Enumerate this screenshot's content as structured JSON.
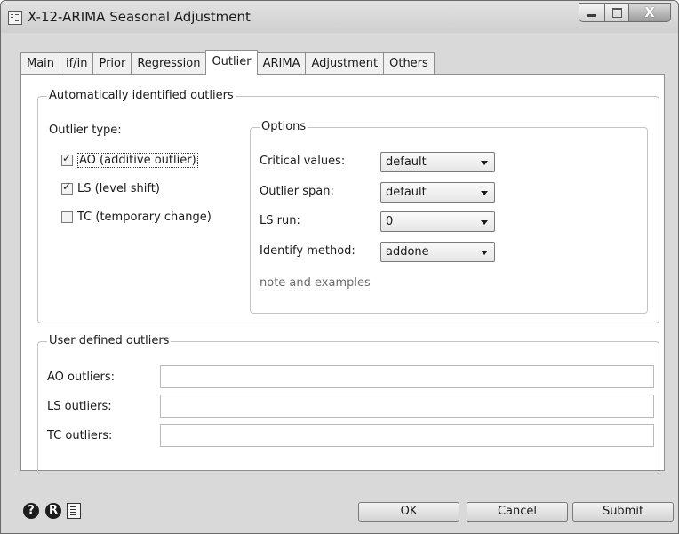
{
  "window": {
    "title": "X-12-ARIMA Seasonal Adjustment",
    "icons": [
      "dialog-icon",
      "minimize-icon",
      "maximize-icon",
      "close-icon"
    ],
    "close_glyph": "X"
  },
  "tabs": [
    {
      "label": "Main",
      "active": false
    },
    {
      "label": "if/in",
      "active": false
    },
    {
      "label": "Prior",
      "active": false
    },
    {
      "label": "Regression",
      "active": false
    },
    {
      "label": "Outlier",
      "active": true
    },
    {
      "label": "ARIMA",
      "active": false
    },
    {
      "label": "Adjustment",
      "active": false
    },
    {
      "label": "Others",
      "active": false
    }
  ],
  "auto": {
    "legend": "Automatically identified outliers",
    "outlier_type_label": "Outlier type:",
    "checkboxes": [
      {
        "label": "AO (additive outlier)",
        "checked": true
      },
      {
        "label": "LS (level shift)",
        "checked": true
      },
      {
        "label": "TC (temporary change)",
        "checked": false
      }
    ],
    "options": {
      "legend": "Options",
      "critical_values": {
        "label": "Critical values:",
        "value": "default"
      },
      "outlier_span": {
        "label": "Outlier span:",
        "value": "default"
      },
      "ls_run": {
        "label": "LS run:",
        "value": "0"
      },
      "identify_method": {
        "label": "Identify method:",
        "value": "addone"
      },
      "note_link": "note and examples"
    }
  },
  "user": {
    "legend": "User defined outliers",
    "fields": [
      {
        "label": "AO outliers:",
        "value": ""
      },
      {
        "label": "LS outliers:",
        "value": ""
      },
      {
        "label": "TC outliers:",
        "value": ""
      }
    ]
  },
  "footer": {
    "help_glyph": "?",
    "reset_glyph": "R",
    "icons": [
      "help-icon",
      "reset-icon",
      "copy-icon"
    ],
    "ok": "OK",
    "cancel": "Cancel",
    "submit": "Submit"
  },
  "colors": {
    "window_bg": "#d9d9d9",
    "panel_bg": "#ffffff",
    "border": "#8e8e8e"
  }
}
